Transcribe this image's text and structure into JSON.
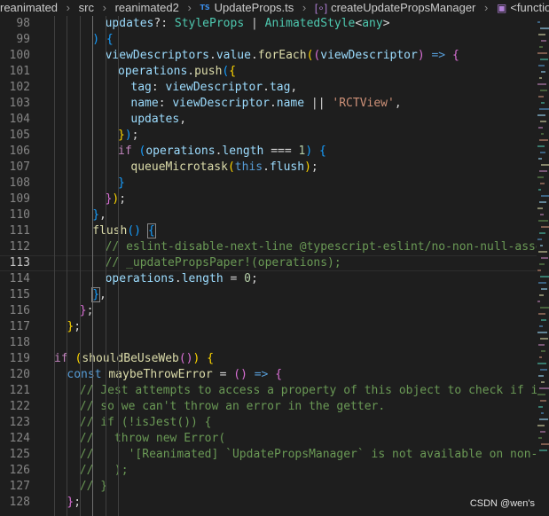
{
  "breadcrumb": {
    "segments": [
      "reanimated",
      "src",
      "reanimated2",
      "UpdateProps.ts",
      "createUpdatePropsManager",
      "<function>"
    ],
    "file_icon": "TS"
  },
  "editor": {
    "current_line": 113,
    "lines": [
      {
        "n": "98",
        "indent": 4,
        "tokens": [
          [
            "var",
            "updates"
          ],
          [
            "",
            "?: "
          ],
          [
            "typ",
            "StyleProps"
          ],
          [
            "",
            " | "
          ],
          [
            "typ",
            "AnimatedStyle"
          ],
          [
            "",
            "<"
          ],
          [
            "typ",
            "any"
          ],
          [
            "",
            ">"
          ]
        ]
      },
      {
        "n": "99",
        "indent": 3,
        "tokens": [
          [
            "br3",
            ")"
          ],
          [
            "",
            " "
          ],
          [
            "br3",
            "{"
          ]
        ]
      },
      {
        "n": "100",
        "indent": 4,
        "tokens": [
          [
            "var",
            "viewDescriptors"
          ],
          [
            "",
            "."
          ],
          [
            "var",
            "value"
          ],
          [
            "",
            "."
          ],
          [
            "fn",
            "forEach"
          ],
          [
            "br1",
            "("
          ],
          [
            "br2",
            "("
          ],
          [
            "var",
            "viewDescriptor"
          ],
          [
            "br2",
            ")"
          ],
          [
            "",
            " "
          ],
          [
            "kw",
            "=>"
          ],
          [
            "",
            " "
          ],
          [
            "br2",
            "{"
          ]
        ]
      },
      {
        "n": "101",
        "indent": 5,
        "tokens": [
          [
            "var",
            "operations"
          ],
          [
            "",
            "."
          ],
          [
            "fn",
            "push"
          ],
          [
            "br3",
            "("
          ],
          [
            "br1",
            "{"
          ]
        ]
      },
      {
        "n": "102",
        "indent": 6,
        "tokens": [
          [
            "var",
            "tag"
          ],
          [
            "",
            ": "
          ],
          [
            "var",
            "viewDescriptor"
          ],
          [
            "",
            "."
          ],
          [
            "var",
            "tag"
          ],
          [
            "",
            ","
          ]
        ]
      },
      {
        "n": "103",
        "indent": 6,
        "tokens": [
          [
            "var",
            "name"
          ],
          [
            "",
            ": "
          ],
          [
            "var",
            "viewDescriptor"
          ],
          [
            "",
            "."
          ],
          [
            "var",
            "name"
          ],
          [
            "",
            " || "
          ],
          [
            "str",
            "'RCTView'"
          ],
          [
            "",
            ","
          ]
        ]
      },
      {
        "n": "104",
        "indent": 6,
        "tokens": [
          [
            "var",
            "updates"
          ],
          [
            "",
            ","
          ]
        ]
      },
      {
        "n": "105",
        "indent": 5,
        "tokens": [
          [
            "br1",
            "}"
          ],
          [
            "br3",
            ")"
          ],
          [
            "",
            ";"
          ]
        ]
      },
      {
        "n": "106",
        "indent": 5,
        "tokens": [
          [
            "ctl",
            "if"
          ],
          [
            "",
            " "
          ],
          [
            "br3",
            "("
          ],
          [
            "var",
            "operations"
          ],
          [
            "",
            "."
          ],
          [
            "var",
            "length"
          ],
          [
            "",
            " === "
          ],
          [
            "num",
            "1"
          ],
          [
            "br3",
            ")"
          ],
          [
            "",
            " "
          ],
          [
            "br3",
            "{"
          ]
        ]
      },
      {
        "n": "107",
        "indent": 6,
        "tokens": [
          [
            "fn",
            "queueMicrotask"
          ],
          [
            "br1",
            "("
          ],
          [
            "kw",
            "this"
          ],
          [
            "",
            "."
          ],
          [
            "var",
            "flush"
          ],
          [
            "br1",
            ")"
          ],
          [
            "",
            ";"
          ]
        ]
      },
      {
        "n": "108",
        "indent": 5,
        "tokens": [
          [
            "br3",
            "}"
          ]
        ]
      },
      {
        "n": "109",
        "indent": 4,
        "tokens": [
          [
            "br2",
            "}"
          ],
          [
            "br1",
            ")"
          ],
          [
            "",
            ";"
          ]
        ]
      },
      {
        "n": "110",
        "indent": 3,
        "tokens": [
          [
            "br3",
            "}"
          ],
          [
            "",
            ","
          ]
        ]
      },
      {
        "n": "111",
        "indent": 3,
        "tokens": [
          [
            "fn",
            "flush"
          ],
          [
            "br3",
            "()"
          ],
          [
            "",
            " "
          ],
          [
            "br3 bmatch",
            "{"
          ]
        ]
      },
      {
        "n": "112",
        "indent": 4,
        "tokens": [
          [
            "cmt",
            "// eslint-disable-next-line @typescript-eslint/no-non-null-assert"
          ]
        ]
      },
      {
        "n": "113",
        "indent": 4,
        "tokens": [
          [
            "cmt",
            "// _updatePropsPaper!(operations);"
          ]
        ]
      },
      {
        "n": "114",
        "indent": 4,
        "tokens": [
          [
            "var",
            "operations"
          ],
          [
            "",
            "."
          ],
          [
            "var",
            "length"
          ],
          [
            "",
            " = "
          ],
          [
            "num",
            "0"
          ],
          [
            "",
            ";"
          ]
        ]
      },
      {
        "n": "115",
        "indent": 3,
        "tokens": [
          [
            "br3 bmatch",
            "}"
          ],
          [
            "",
            ","
          ]
        ]
      },
      {
        "n": "116",
        "indent": 2,
        "tokens": [
          [
            "br2",
            "}"
          ],
          [
            "",
            ";"
          ]
        ]
      },
      {
        "n": "117",
        "indent": 1,
        "tokens": [
          [
            "br1",
            "}"
          ],
          [
            "",
            ";"
          ]
        ]
      },
      {
        "n": "118",
        "indent": 0,
        "tokens": []
      },
      {
        "n": "119",
        "indent": 0,
        "tokens": [
          [
            "ctl",
            "if"
          ],
          [
            "",
            " "
          ],
          [
            "br1",
            "("
          ],
          [
            "fn",
            "shouldBeUseWeb"
          ],
          [
            "br2",
            "()"
          ],
          [
            "br1",
            ")"
          ],
          [
            "",
            " "
          ],
          [
            "br1",
            "{"
          ]
        ]
      },
      {
        "n": "120",
        "indent": 1,
        "tokens": [
          [
            "kw",
            "const"
          ],
          [
            "",
            " "
          ],
          [
            "fn",
            "maybeThrowError"
          ],
          [
            "",
            " = "
          ],
          [
            "br2",
            "()"
          ],
          [
            "",
            " "
          ],
          [
            "kw",
            "=>"
          ],
          [
            "",
            " "
          ],
          [
            "br2",
            "{"
          ]
        ]
      },
      {
        "n": "121",
        "indent": 2,
        "tokens": [
          [
            "cmt",
            "// Jest attempts to access a property of this object to check if it is a"
          ]
        ]
      },
      {
        "n": "122",
        "indent": 2,
        "tokens": [
          [
            "cmt",
            "// so we can't throw an error in the getter."
          ]
        ]
      },
      {
        "n": "123",
        "indent": 2,
        "tokens": [
          [
            "cmt",
            "// if (!isJest()) {"
          ]
        ]
      },
      {
        "n": "124",
        "indent": 2,
        "tokens": [
          [
            "cmt",
            "//   throw new Error("
          ]
        ]
      },
      {
        "n": "125",
        "indent": 2,
        "tokens": [
          [
            "cmt",
            "//     '[Reanimated] `UpdatePropsManager` is not available on non-native"
          ]
        ]
      },
      {
        "n": "126",
        "indent": 2,
        "tokens": [
          [
            "cmt",
            "//   );"
          ]
        ]
      },
      {
        "n": "127",
        "indent": 2,
        "tokens": [
          [
            "cmt",
            "// }"
          ]
        ]
      },
      {
        "n": "128",
        "indent": 1,
        "tokens": [
          [
            "br2",
            "}"
          ],
          [
            "",
            ";"
          ]
        ]
      }
    ]
  },
  "watermark": "CSDN @wen's",
  "colors": {
    "background": "#1e1e1e",
    "keyword": "#569cd6",
    "control": "#c586c0",
    "function": "#dcdcaa",
    "variable": "#9cdcfe",
    "type": "#4ec9b0",
    "string": "#ce9178",
    "number": "#b5cea8",
    "comment": "#6a9955"
  }
}
